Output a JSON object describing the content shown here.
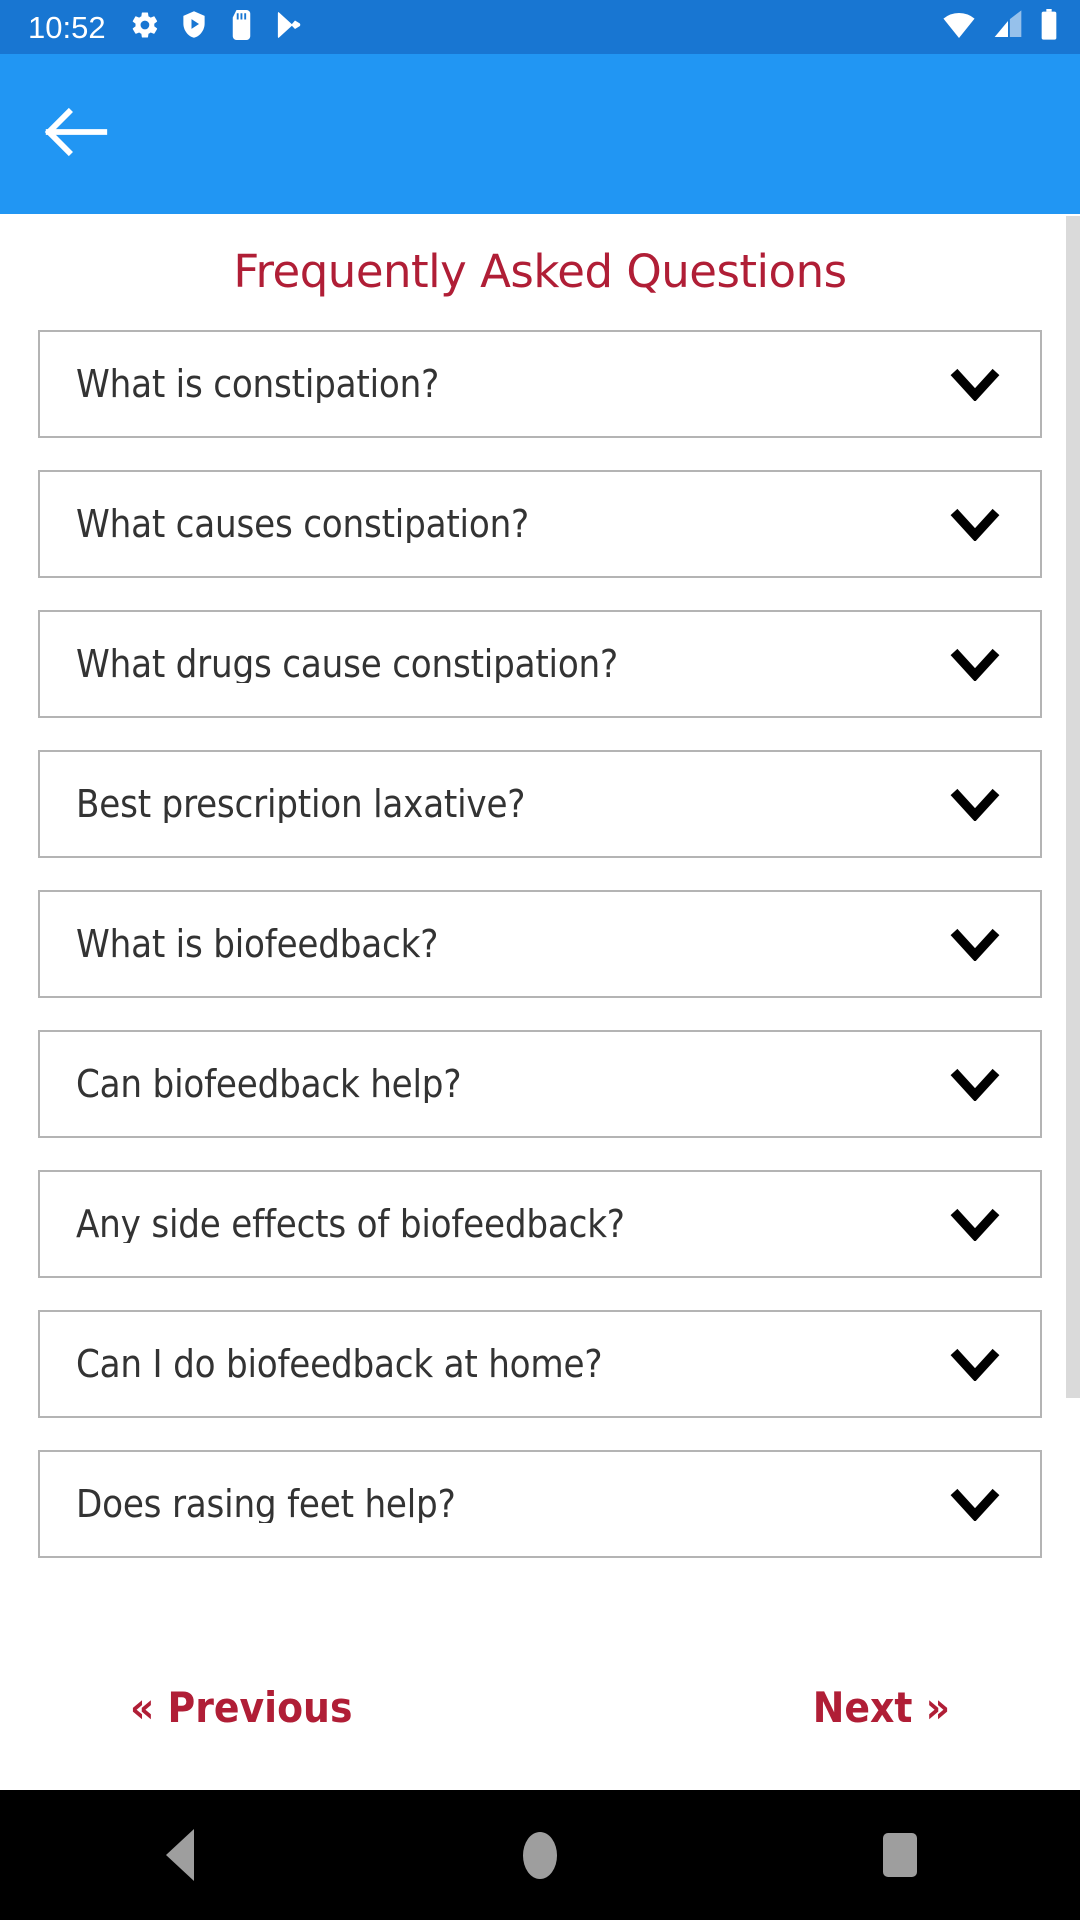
{
  "status_bar": {
    "time": "10:52",
    "left_icons": [
      "gear-icon",
      "shield-play-icon",
      "sd-card-icon",
      "play-store-icon"
    ],
    "right_icons": [
      "wifi-icon",
      "cellular-signal-icon",
      "battery-icon"
    ],
    "background_color": "#1876d2",
    "foreground_color": "#ffffff"
  },
  "app_bar": {
    "back_icon": "back-arrow-icon",
    "background_color": "#2196f3"
  },
  "main": {
    "title": "Frequently Asked Questions",
    "title_color": "#b01e36",
    "faq_items": [
      {
        "question": "What is constipation?",
        "expand_icon": "chevron-down-icon"
      },
      {
        "question": "What causes constipation?",
        "expand_icon": "chevron-down-icon"
      },
      {
        "question": "What drugs cause constipation?",
        "expand_icon": "chevron-down-icon"
      },
      {
        "question": "Best prescription laxative?",
        "expand_icon": "chevron-down-icon"
      },
      {
        "question": "What is biofeedback?",
        "expand_icon": "chevron-down-icon"
      },
      {
        "question": "Can biofeedback help?",
        "expand_icon": "chevron-down-icon"
      },
      {
        "question": "Any side effects of biofeedback?",
        "expand_icon": "chevron-down-icon"
      },
      {
        "question": "Can I do biofeedback at home?",
        "expand_icon": "chevron-down-icon"
      },
      {
        "question": "Does rasing feet help?",
        "expand_icon": "chevron-down-icon"
      }
    ],
    "item_border_color": "#b4b4b4",
    "question_color": "#333333"
  },
  "pager": {
    "previous_label": "« Previous",
    "next_label": "Next »",
    "color": "#b01e36"
  },
  "scrollbar": {
    "thumb_color": "#dadada"
  },
  "nav_bar": {
    "background_color": "#000000",
    "icon_color": "#9e9e9e",
    "buttons": [
      "back-triangle-icon",
      "home-circle-icon",
      "recents-square-icon"
    ]
  }
}
